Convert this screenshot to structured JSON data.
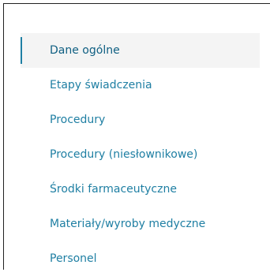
{
  "menu": {
    "items": [
      {
        "label": "Dane ogólne",
        "active": true
      },
      {
        "label": "Etapy świadczenia",
        "active": false
      },
      {
        "label": "Procedury",
        "active": false
      },
      {
        "label": "Procedury (niesłownikowe)",
        "active": false
      },
      {
        "label": "Środki farmaceutyczne",
        "active": false
      },
      {
        "label": "Materiały/wyroby medyczne",
        "active": false
      },
      {
        "label": "Personel",
        "active": false
      }
    ]
  },
  "colors": {
    "link": "#1f7fa3",
    "active_indicator": "#1f7fa3",
    "active_background": "#f4f4f4"
  }
}
